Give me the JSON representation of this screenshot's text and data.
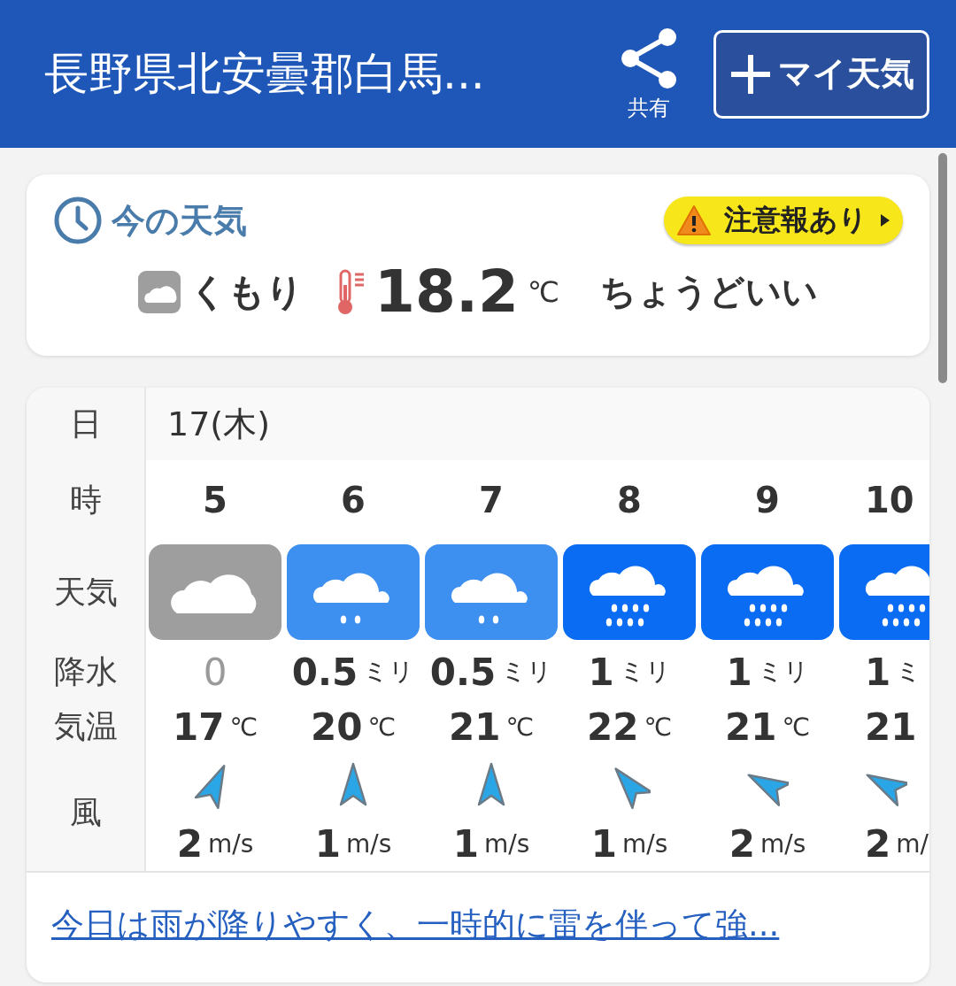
{
  "header": {
    "title": "長野県北安曇郡白馬...",
    "share_label": "共有",
    "my_weather_button": "マイ天気"
  },
  "current": {
    "heading": "今の天気",
    "alert": "注意報あり",
    "condition": {
      "kind": "cloudy",
      "label": "くもり"
    },
    "temperature": "18.2",
    "temperature_unit": "℃",
    "feeling": "ちょうどいい"
  },
  "forecast": {
    "row_labels": [
      "日",
      "時",
      "天気",
      "降水",
      "気温",
      "風"
    ],
    "date": "17(木)",
    "hours": [
      {
        "hour": "5",
        "kind": "cloudy",
        "precip": "0",
        "dry": true,
        "temp": "17",
        "temp_unit": "℃",
        "wind_arrow": {
          "kind": "nne"
        },
        "wind": "2",
        "wind_unit": "m/s"
      },
      {
        "hour": "6",
        "kind": "light-rain",
        "precip": "0.5",
        "precip_unit": "ミリ",
        "dry": false,
        "temp": "20",
        "temp_unit": "℃",
        "wind_arrow": {
          "kind": "n"
        },
        "wind": "1",
        "wind_unit": "m/s"
      },
      {
        "hour": "7",
        "kind": "light-rain",
        "precip": "0.5",
        "precip_unit": "ミリ",
        "dry": false,
        "temp": "21",
        "temp_unit": "℃",
        "wind_arrow": {
          "kind": "n"
        },
        "wind": "1",
        "wind_unit": "m/s"
      },
      {
        "hour": "8",
        "kind": "rain",
        "precip": "1",
        "precip_unit": "ミリ",
        "dry": false,
        "temp": "22",
        "temp_unit": "℃",
        "wind_arrow": {
          "kind": "nw"
        },
        "wind": "1",
        "wind_unit": "m/s"
      },
      {
        "hour": "9",
        "kind": "rain",
        "precip": "1",
        "precip_unit": "ミリ",
        "dry": false,
        "temp": "21",
        "temp_unit": "℃",
        "wind_arrow": {
          "kind": "wnw"
        },
        "wind": "2",
        "wind_unit": "m/s"
      },
      {
        "hour": "10",
        "kind": "rain",
        "precip": "1",
        "precip_unit": "ミ",
        "dry": false,
        "temp": "21",
        "wind_arrow": {
          "kind": "wnw"
        },
        "wind": "2",
        "wind_unit": "m/"
      }
    ],
    "summary_link": "今日は雨が降りやすく、一時的に雷を伴って強..."
  }
}
